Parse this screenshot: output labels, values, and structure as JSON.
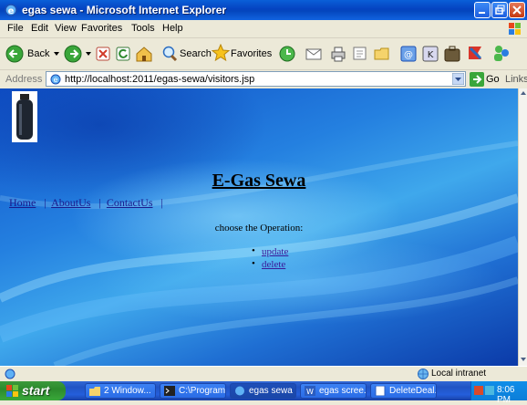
{
  "window": {
    "title": "egas sewa - Microsoft Internet Explorer"
  },
  "menu": [
    "File",
    "Edit",
    "View",
    "Favorites",
    "Tools",
    "Help"
  ],
  "toolbar": {
    "back_label": "Back",
    "search_label": "Search",
    "favorites_label": "Favorites"
  },
  "address": {
    "label": "Address",
    "url": "http://localhost:2011/egas-sewa/visitors.jsp",
    "go_label": "Go",
    "links_label": "Links"
  },
  "page": {
    "heading": "E-Gas Sewa",
    "nav": [
      "Home",
      "AboutUs",
      "ContactUs"
    ],
    "prompt": "choose the Operation:",
    "operations": [
      "update",
      "delete"
    ]
  },
  "status": {
    "zone": "Local intranet"
  },
  "taskbar": {
    "start": "start",
    "tasks": [
      "2 Window...",
      "C:\\Program...",
      "egas sewa ...",
      "egas scree...",
      "DeleteDeal..."
    ],
    "clock": "8:06 PM"
  }
}
